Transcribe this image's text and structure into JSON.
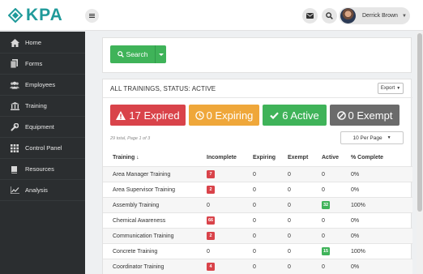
{
  "app": {
    "logo_text": "KPA",
    "brand_color": "#1f9a9a"
  },
  "header": {
    "mail_icon": "envelope-icon",
    "search_icon": "search-icon",
    "user_name": "Derrick Brown"
  },
  "sidebar": {
    "items": [
      {
        "label": "Home",
        "icon": "home-icon"
      },
      {
        "label": "Forms",
        "icon": "forms-icon"
      },
      {
        "label": "Employees",
        "icon": "employees-icon"
      },
      {
        "label": "Training",
        "icon": "training-icon"
      },
      {
        "label": "Equipment",
        "icon": "wrench-icon"
      },
      {
        "label": "Control Panel",
        "icon": "grid-icon"
      },
      {
        "label": "Resources",
        "icon": "book-icon"
      },
      {
        "label": "Analysis",
        "icon": "chart-icon"
      }
    ]
  },
  "search": {
    "label": "Search"
  },
  "trainings": {
    "title": "ALL TRAININGS, STATUS: ACTIVE",
    "export_label": "Export",
    "stats": {
      "expired": {
        "label": "17 Expired",
        "color": "#d9434a"
      },
      "expiring": {
        "label": "0 Expiring",
        "color": "#efa73a"
      },
      "active": {
        "label": "6 Active",
        "color": "#3fb359"
      },
      "exempt": {
        "label": "0 Exempt",
        "color": "#6b6b6b"
      }
    },
    "meta": "29 total, Page 1 of 3",
    "per_page": "10 Per Page",
    "columns": [
      "Training ↓",
      "Incomplete",
      "Expiring",
      "Exempt",
      "Active",
      "% Complete"
    ],
    "rows": [
      {
        "name": "Area Manager Training",
        "incomplete": "7",
        "expiring": "0",
        "exempt": "0",
        "active": "0",
        "pct": "0%"
      },
      {
        "name": "Area Supervisor Training",
        "incomplete": "2",
        "expiring": "0",
        "exempt": "0",
        "active": "0",
        "pct": "0%"
      },
      {
        "name": "Assembly Training",
        "incomplete": "0",
        "expiring": "0",
        "exempt": "0",
        "active": "32",
        "pct": "100%"
      },
      {
        "name": "Chemical Awareness",
        "incomplete": "66",
        "expiring": "0",
        "exempt": "0",
        "active": "0",
        "pct": "0%"
      },
      {
        "name": "Communication Training",
        "incomplete": "2",
        "expiring": "0",
        "exempt": "0",
        "active": "0",
        "pct": "0%"
      },
      {
        "name": "Concrete Training",
        "incomplete": "0",
        "expiring": "0",
        "exempt": "0",
        "active": "15",
        "pct": "100%"
      },
      {
        "name": "Coordinator Training",
        "incomplete": "4",
        "expiring": "0",
        "exempt": "0",
        "active": "0",
        "pct": "0%"
      }
    ]
  }
}
